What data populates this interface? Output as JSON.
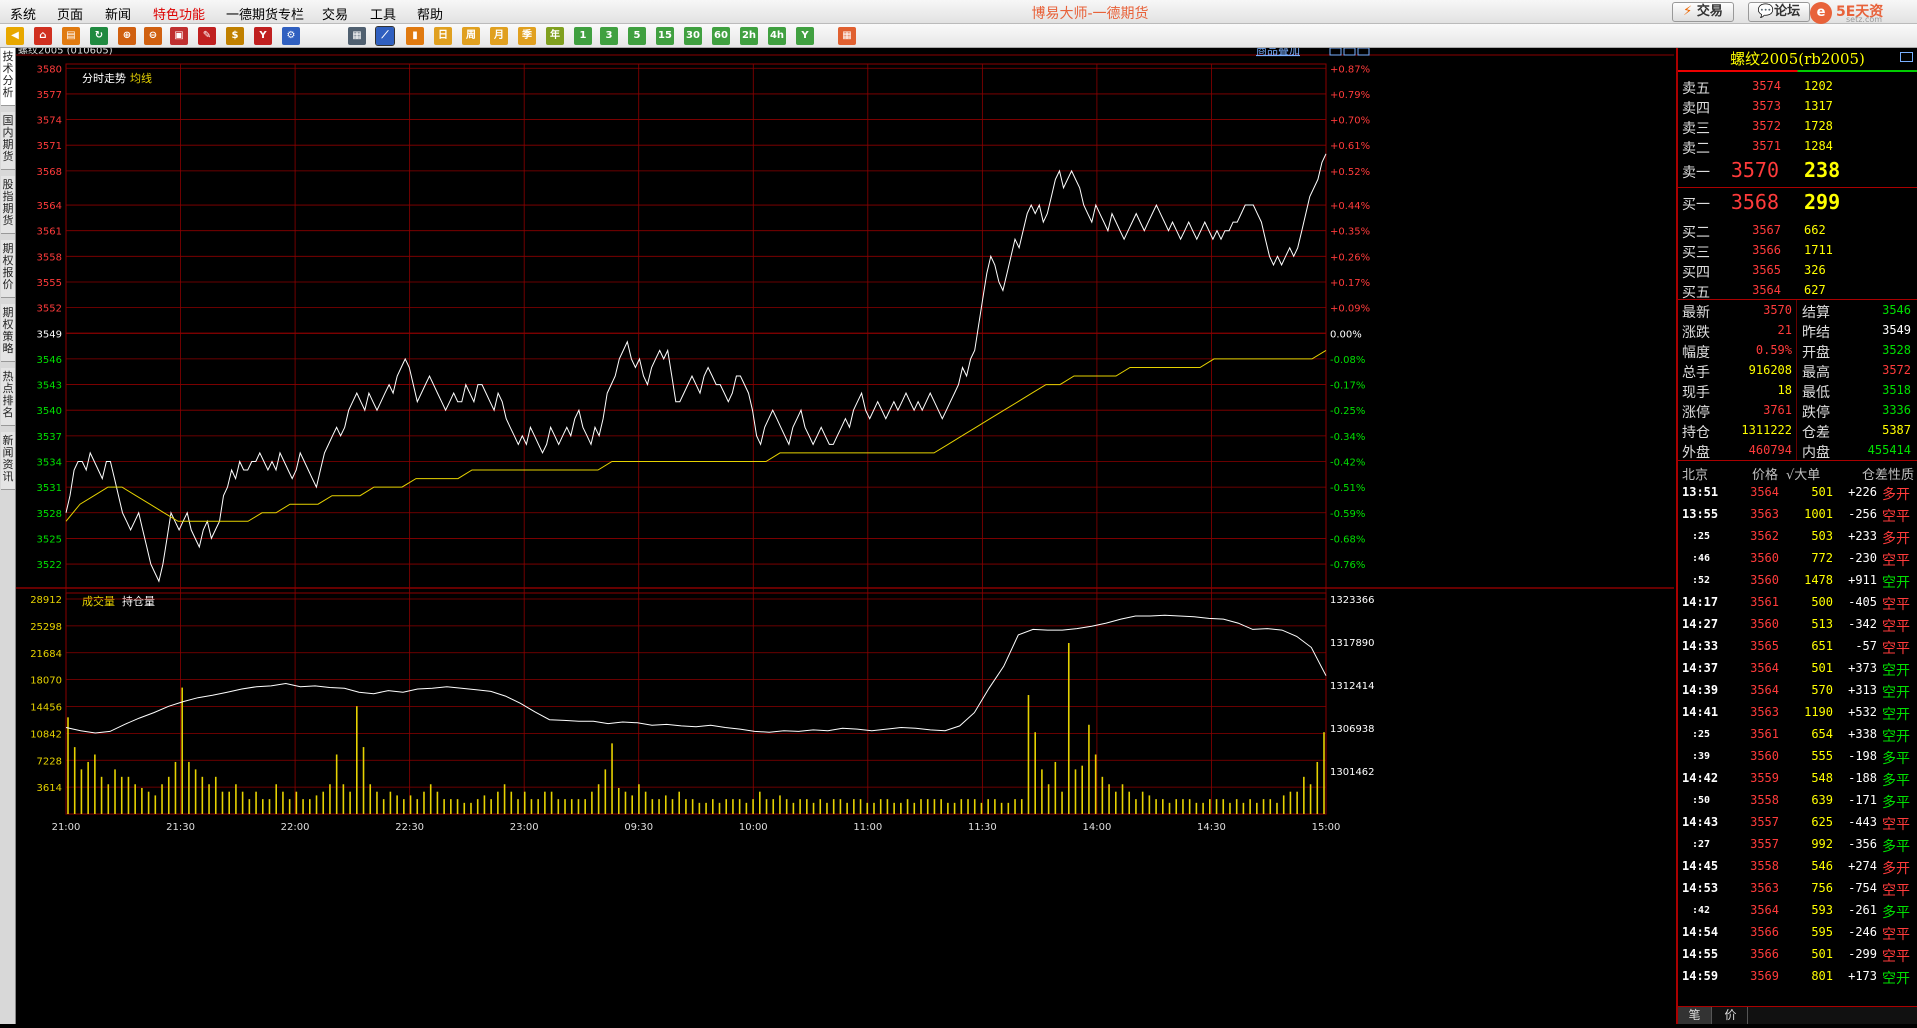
{
  "menu": {
    "items": [
      "系统",
      "页面",
      "新闻",
      "特色功能",
      "一德期货专栏",
      "交易",
      "工具",
      "帮助"
    ],
    "hot_index": 3,
    "app_title": "博易大师-一德期货",
    "trade_btn": "交易",
    "forum_btn": "论坛",
    "logo_text": "5E天资",
    "logo_sub": "setz.com"
  },
  "toolbar": {
    "icons": [
      "back-icon",
      "home-icon",
      "folder-icon",
      "refresh-icon",
      "zoom-in-icon",
      "zoom-out-icon",
      "window-icon",
      "pencil-icon",
      "gold-icon",
      "cup-icon",
      "tool-icon",
      "list-icon",
      "intraday-chart-icon",
      "kline-icon",
      "day-icon",
      "week-icon",
      "month-icon",
      "quarter-icon",
      "year-icon",
      "min1-icon",
      "min3-icon",
      "min5-icon",
      "min15-icon",
      "min30-icon",
      "min60-icon",
      "min2h-icon",
      "min4h-icon",
      "custom-period-icon",
      "calculator-icon"
    ],
    "period_labels": [
      "日",
      "周",
      "月",
      "季",
      "年",
      "1",
      "3",
      "5",
      "15",
      "30",
      "60",
      "2h",
      "4h",
      "Y"
    ]
  },
  "side_tabs": [
    "技术分析",
    "国内期货",
    "股指期货",
    "期权报价",
    "期权策略",
    "热点排名",
    "新闻资讯"
  ],
  "chart_header": {
    "symbol": "螺纹2005 (010605)",
    "overlay_link": "商品叠加",
    "price_title": "分时走势",
    "avg_label": "均线",
    "vol_title": "成交量",
    "oi_title": "持仓量"
  },
  "chart_data": {
    "type": "line",
    "price_ticks": [
      3580,
      3577,
      3574,
      3571,
      3568,
      3564,
      3561,
      3558,
      3555,
      3552,
      3549,
      3546,
      3543,
      3540,
      3537,
      3534,
      3531,
      3528,
      3525,
      3522
    ],
    "pct_ticks": [
      "+0.87%",
      "+0.79%",
      "+0.70%",
      "+0.61%",
      "+0.52%",
      "+0.44%",
      "+0.35%",
      "+0.26%",
      "+0.17%",
      "+0.09%",
      "0.00%",
      "-0.08%",
      "-0.17%",
      "-0.25%",
      "-0.34%",
      "-0.42%",
      "-0.51%",
      "-0.59%",
      "-0.68%",
      "-0.76%"
    ],
    "prev_settle": 3549,
    "ylim": [
      3519.2,
      3580.5
    ],
    "x_ticks": [
      "21:00",
      "21:30",
      "22:00",
      "22:30",
      "23:00",
      "09:30",
      "10:00",
      "11:00",
      "11:30",
      "14:00",
      "14:30",
      "15:00"
    ],
    "price": [
      3528,
      3530,
      3533,
      3534,
      3534,
      3533,
      3535,
      3534,
      3533,
      3532,
      3534,
      3534,
      3532,
      3530,
      3528,
      3527,
      3526,
      3527,
      3528,
      3526,
      3524,
      3522,
      3521,
      3520,
      3522,
      3525,
      3528,
      3527,
      3526,
      3527,
      3528,
      3526,
      3525,
      3524,
      3526,
      3527,
      3525,
      3526,
      3527,
      3530,
      3531,
      3533,
      3532,
      3534,
      3533,
      3533,
      3534,
      3534,
      3535,
      3534,
      3533,
      3534,
      3533,
      3535,
      3534,
      3533,
      3532,
      3533,
      3535,
      3534,
      3533,
      3532,
      3531,
      3533,
      3535,
      3536,
      3537,
      3538,
      3537,
      3538,
      3540,
      3541,
      3542,
      3541,
      3540,
      3542,
      3541,
      3540,
      3541,
      3542,
      3543,
      3542,
      3544,
      3545,
      3546,
      3545,
      3543,
      3541,
      3542,
      3543,
      3544,
      3543,
      3542,
      3541,
      3540,
      3541,
      3542,
      3541,
      3541,
      3543,
      3542,
      3541,
      3543,
      3543,
      3542,
      3541,
      3540,
      3542,
      3541,
      3539,
      3538,
      3537,
      3536,
      3537,
      3536,
      3538,
      3537,
      3536,
      3535,
      3536,
      3538,
      3537,
      3536,
      3537,
      3538,
      3537,
      3539,
      3540,
      3538,
      3537,
      3536,
      3538,
      3537,
      3539,
      3542,
      3543,
      3544,
      3546,
      3547,
      3548,
      3546,
      3545,
      3546,
      3544,
      3543,
      3545,
      3546,
      3547,
      3546,
      3547,
      3544,
      3541,
      3541,
      3542,
      3543,
      3544,
      3543,
      3542,
      3544,
      3545,
      3544,
      3543,
      3543,
      3542,
      3541,
      3542,
      3544,
      3544,
      3543,
      3542,
      3540,
      3537,
      3536,
      3538,
      3539,
      3540,
      3539,
      3538,
      3537,
      3536,
      3538,
      3539,
      3540,
      3538,
      3537,
      3536,
      3537,
      3538,
      3537,
      3536,
      3536,
      3537,
      3538,
      3539,
      3538,
      3540,
      3541,
      3542,
      3540,
      3539,
      3540,
      3541,
      3540,
      3539,
      3540,
      3541,
      3540,
      3541,
      3542,
      3541,
      3540,
      3541,
      3540,
      3541,
      3542,
      3541,
      3540,
      3539,
      3540,
      3541,
      3542,
      3543,
      3545,
      3544,
      3546,
      3547,
      3550,
      3553,
      3556,
      3558,
      3557,
      3555,
      3554,
      3556,
      3558,
      3560,
      3559,
      3561,
      3563,
      3564,
      3563,
      3564,
      3562,
      3563,
      3565,
      3567,
      3568,
      3566,
      3567,
      3568,
      3567,
      3566,
      3564,
      3563,
      3562,
      3564,
      3563,
      3562,
      3561,
      3563,
      3562,
      3561,
      3560,
      3561,
      3562,
      3563,
      3562,
      3561,
      3562,
      3563,
      3564,
      3563,
      3562,
      3561,
      3562,
      3561,
      3560,
      3561,
      3562,
      3561,
      3560,
      3561,
      3562,
      3561,
      3560,
      3561,
      3560,
      3561,
      3561,
      3562,
      3562,
      3563,
      3564,
      3564,
      3564,
      3563,
      3562,
      3560,
      3558,
      3557,
      3558,
      3557,
      3558,
      3559,
      3558,
      3559,
      3561,
      3563,
      3565,
      3566,
      3567,
      3569,
      3570
    ],
    "avg_line": [
      3527,
      3529,
      3530,
      3531,
      3531,
      3530,
      3529,
      3528,
      3527,
      3527,
      3527,
      3527,
      3527,
      3527,
      3528,
      3528,
      3529,
      3529,
      3529,
      3530,
      3530,
      3530,
      3531,
      3531,
      3531,
      3532,
      3532,
      3532,
      3532,
      3533,
      3533,
      3533,
      3533,
      3533,
      3533,
      3533,
      3533,
      3533,
      3533,
      3534,
      3534,
      3534,
      3534,
      3534,
      3534,
      3534,
      3534,
      3534,
      3534,
      3534,
      3534,
      3535,
      3535,
      3535,
      3535,
      3535,
      3535,
      3535,
      3535,
      3535,
      3535,
      3535,
      3535,
      3536,
      3537,
      3538,
      3539,
      3540,
      3541,
      3542,
      3543,
      3543,
      3544,
      3544,
      3544,
      3544,
      3545,
      3545,
      3545,
      3545,
      3545,
      3545,
      3546,
      3546,
      3546,
      3546,
      3546,
      3546,
      3546,
      3546,
      3547
    ],
    "volume_ticks": [
      28912,
      25298,
      21684,
      18070,
      14456,
      10842,
      7228,
      3614
    ],
    "oi_ticks": [
      1323366,
      1317890,
      1312414,
      1306938,
      1301462
    ],
    "oi_ylim": [
      1295986,
      1323366
    ],
    "vol_max": 28912,
    "open_interest": [
      1307000,
      1306600,
      1306300,
      1306500,
      1307400,
      1308200,
      1308900,
      1309700,
      1310300,
      1310800,
      1311100,
      1311500,
      1311900,
      1312200,
      1312300,
      1312600,
      1312200,
      1312300,
      1312100,
      1312000,
      1311500,
      1311300,
      1311700,
      1311500,
      1311900,
      1312000,
      1312200,
      1312000,
      1311800,
      1311600,
      1311000,
      1310100,
      1309000,
      1308000,
      1307900,
      1307800,
      1307800,
      1307500,
      1307700,
      1307600,
      1307300,
      1307400,
      1307200,
      1307100,
      1307300,
      1307000,
      1306800,
      1306500,
      1306400,
      1306600,
      1306500,
      1306700,
      1306600,
      1306900,
      1306800,
      1306600,
      1306800,
      1307000,
      1306900,
      1306700,
      1306600,
      1307200,
      1308900,
      1312000,
      1314800,
      1318800,
      1319500,
      1319400,
      1319400,
      1319600,
      1319900,
      1320300,
      1320800,
      1321200,
      1321200,
      1321300,
      1321200,
      1321100,
      1320900,
      1320800,
      1320300,
      1319500,
      1319600,
      1319400,
      1318600,
      1317200,
      1313600
    ],
    "volume": [
      13000,
      9000,
      6000,
      7000,
      8000,
      5000,
      4000,
      6000,
      5000,
      5000,
      4000,
      3500,
      3000,
      2500,
      4000,
      5000,
      7000,
      17000,
      7000,
      6000,
      5000,
      4000,
      5000,
      3000,
      3000,
      4000,
      3000,
      2000,
      3000,
      2000,
      2000,
      4000,
      3000,
      2000,
      3000,
      2000,
      2000,
      2500,
      3000,
      4000,
      8000,
      4000,
      3000,
      14500,
      9000,
      4000,
      3000,
      2000,
      3000,
      2500,
      2000,
      2500,
      2000,
      3000,
      4000,
      3000,
      2000,
      2000,
      2000,
      1500,
      1500,
      2000,
      2500,
      2000,
      3000,
      4000,
      3000,
      2000,
      3000,
      2000,
      2000,
      3000,
      3000,
      2000,
      2000,
      2000,
      2000,
      2000,
      3000,
      4000,
      6000,
      9500,
      3500,
      3000,
      2500,
      4000,
      3000,
      2000,
      2000,
      2500,
      2000,
      3000,
      2000,
      2000,
      1500,
      1500,
      2000,
      1500,
      2000,
      2000,
      2000,
      1500,
      2000,
      3000,
      2000,
      2000,
      2500,
      2000,
      1500,
      2000,
      2000,
      1500,
      2000,
      1500,
      2000,
      2000,
      1500,
      2000,
      2000,
      1500,
      1500,
      2000,
      2000,
      1500,
      1500,
      2000,
      1500,
      2000,
      2000,
      2000,
      2000,
      1500,
      1500,
      2000,
      2000,
      2000,
      1500,
      2000,
      2000,
      1500,
      1500,
      2000,
      2000,
      16000,
      11000,
      6000,
      4000,
      7000,
      3000,
      23000,
      6000,
      6500,
      12000,
      8000,
      5000,
      4000,
      3000,
      4000,
      3000,
      2000,
      3000,
      2500,
      2000,
      2000,
      1500,
      2000,
      2000,
      2000,
      1500,
      1500,
      2000,
      2000,
      2000,
      1500,
      2000,
      1500,
      2000,
      1500,
      2000,
      2000,
      1500,
      2500,
      3000,
      3000,
      5000,
      4000,
      7000,
      11000
    ]
  },
  "quote": {
    "title": "螺纹2005(rb2005)",
    "asks": [
      {
        "label": "卖五",
        "price": "3574",
        "vol": "1202"
      },
      {
        "label": "卖四",
        "price": "3573",
        "vol": "1317"
      },
      {
        "label": "卖三",
        "price": "3572",
        "vol": "1728"
      },
      {
        "label": "卖二",
        "price": "3571",
        "vol": "1284"
      },
      {
        "label": "卖一",
        "price": "3570",
        "vol": "238"
      }
    ],
    "bids": [
      {
        "label": "买一",
        "price": "3568",
        "vol": "299"
      },
      {
        "label": "买二",
        "price": "3567",
        "vol": "662"
      },
      {
        "label": "买三",
        "price": "3566",
        "vol": "1711"
      },
      {
        "label": "买四",
        "price": "3565",
        "vol": "326"
      },
      {
        "label": "买五",
        "price": "3564",
        "vol": "627"
      }
    ],
    "stats": [
      {
        "l1": "最新",
        "v1": "3570",
        "c1": "red",
        "l2": "结算",
        "v2": "3546",
        "c2": "green"
      },
      {
        "l1": "涨跌",
        "v1": "21",
        "c1": "red",
        "l2": "昨结",
        "v2": "3549",
        "c2": "white"
      },
      {
        "l1": "幅度",
        "v1": "0.59%",
        "c1": "red",
        "l2": "开盘",
        "v2": "3528",
        "c2": "green"
      },
      {
        "l1": "总手",
        "v1": "916208",
        "c1": "yellow",
        "l2": "最高",
        "v2": "3572",
        "c2": "red"
      },
      {
        "l1": "现手",
        "v1": "18",
        "c1": "yellow",
        "l2": "最低",
        "v2": "3518",
        "c2": "green"
      },
      {
        "l1": "涨停",
        "v1": "3761",
        "c1": "red",
        "l2": "跌停",
        "v2": "3336",
        "c2": "green"
      },
      {
        "l1": "持仓",
        "v1": "1311222",
        "c1": "yellow",
        "l2": "仓差",
        "v2": "5387",
        "c2": "yellow"
      },
      {
        "l1": "外盘",
        "v1": "460794",
        "c1": "red",
        "l2": "内盘",
        "v2": "455414",
        "c2": "green"
      }
    ],
    "ticks_header": [
      "北京",
      "价格",
      "√大单",
      "仓差",
      "性质"
    ],
    "ticks": [
      {
        "t": "13:51",
        "p": "3564",
        "v": "501",
        "d": "+226",
        "n": "多开",
        "pc": "red",
        "nc": "red"
      },
      {
        "t": "13:55",
        "p": "3563",
        "v": "1001",
        "d": "-256",
        "n": "空平",
        "pc": "red",
        "nc": "red"
      },
      {
        "t": ":25",
        "p": "3562",
        "v": "503",
        "d": "+233",
        "n": "多开",
        "pc": "red",
        "nc": "red"
      },
      {
        "t": ":46",
        "p": "3560",
        "v": "772",
        "d": "-230",
        "n": "空平",
        "pc": "red",
        "nc": "red"
      },
      {
        "t": ":52",
        "p": "3560",
        "v": "1478",
        "d": "+911",
        "n": "空开",
        "pc": "red",
        "nc": "green"
      },
      {
        "t": "14:17",
        "p": "3561",
        "v": "500",
        "d": "-405",
        "n": "空平",
        "pc": "red",
        "nc": "red"
      },
      {
        "t": "14:27",
        "p": "3560",
        "v": "513",
        "d": "-342",
        "n": "空平",
        "pc": "red",
        "nc": "red"
      },
      {
        "t": "14:33",
        "p": "3565",
        "v": "651",
        "d": "-57",
        "n": "空平",
        "pc": "red",
        "nc": "red"
      },
      {
        "t": "14:37",
        "p": "3564",
        "v": "501",
        "d": "+373",
        "n": "空开",
        "pc": "red",
        "nc": "green"
      },
      {
        "t": "14:39",
        "p": "3564",
        "v": "570",
        "d": "+313",
        "n": "空开",
        "pc": "red",
        "nc": "green"
      },
      {
        "t": "14:41",
        "p": "3563",
        "v": "1190",
        "d": "+532",
        "n": "空开",
        "pc": "red",
        "nc": "green"
      },
      {
        "t": ":25",
        "p": "3561",
        "v": "654",
        "d": "+338",
        "n": "空开",
        "pc": "red",
        "nc": "green"
      },
      {
        "t": ":39",
        "p": "3560",
        "v": "555",
        "d": "-198",
        "n": "多平",
        "pc": "red",
        "nc": "green"
      },
      {
        "t": "14:42",
        "p": "3559",
        "v": "548",
        "d": "-188",
        "n": "多平",
        "pc": "red",
        "nc": "green"
      },
      {
        "t": ":50",
        "p": "3558",
        "v": "639",
        "d": "-171",
        "n": "多平",
        "pc": "red",
        "nc": "green"
      },
      {
        "t": "14:43",
        "p": "3557",
        "v": "625",
        "d": "-443",
        "n": "空平",
        "pc": "red",
        "nc": "red"
      },
      {
        "t": ":27",
        "p": "3557",
        "v": "992",
        "d": "-356",
        "n": "多平",
        "pc": "red",
        "nc": "green"
      },
      {
        "t": "14:45",
        "p": "3558",
        "v": "546",
        "d": "+274",
        "n": "多开",
        "pc": "red",
        "nc": "red"
      },
      {
        "t": "14:53",
        "p": "3563",
        "v": "756",
        "d": "-754",
        "n": "空平",
        "pc": "red",
        "nc": "red"
      },
      {
        "t": ":42",
        "p": "3564",
        "v": "593",
        "d": "-261",
        "n": "多平",
        "pc": "red",
        "nc": "green"
      },
      {
        "t": "14:54",
        "p": "3566",
        "v": "595",
        "d": "-246",
        "n": "空平",
        "pc": "red",
        "nc": "red"
      },
      {
        "t": "14:55",
        "p": "3566",
        "v": "501",
        "d": "-299",
        "n": "空平",
        "pc": "red",
        "nc": "red"
      },
      {
        "t": "14:59",
        "p": "3569",
        "v": "801",
        "d": "+173",
        "n": "空开",
        "pc": "red",
        "nc": "green"
      }
    ],
    "bottom_tabs": [
      "笔",
      "价"
    ]
  },
  "colors": {
    "up": "#ff3b3b",
    "down": "#00e000",
    "grid": "#8b0000",
    "price_line": "#ffffff",
    "avg_line": "#e6d200",
    "volume": "#e6d200"
  }
}
